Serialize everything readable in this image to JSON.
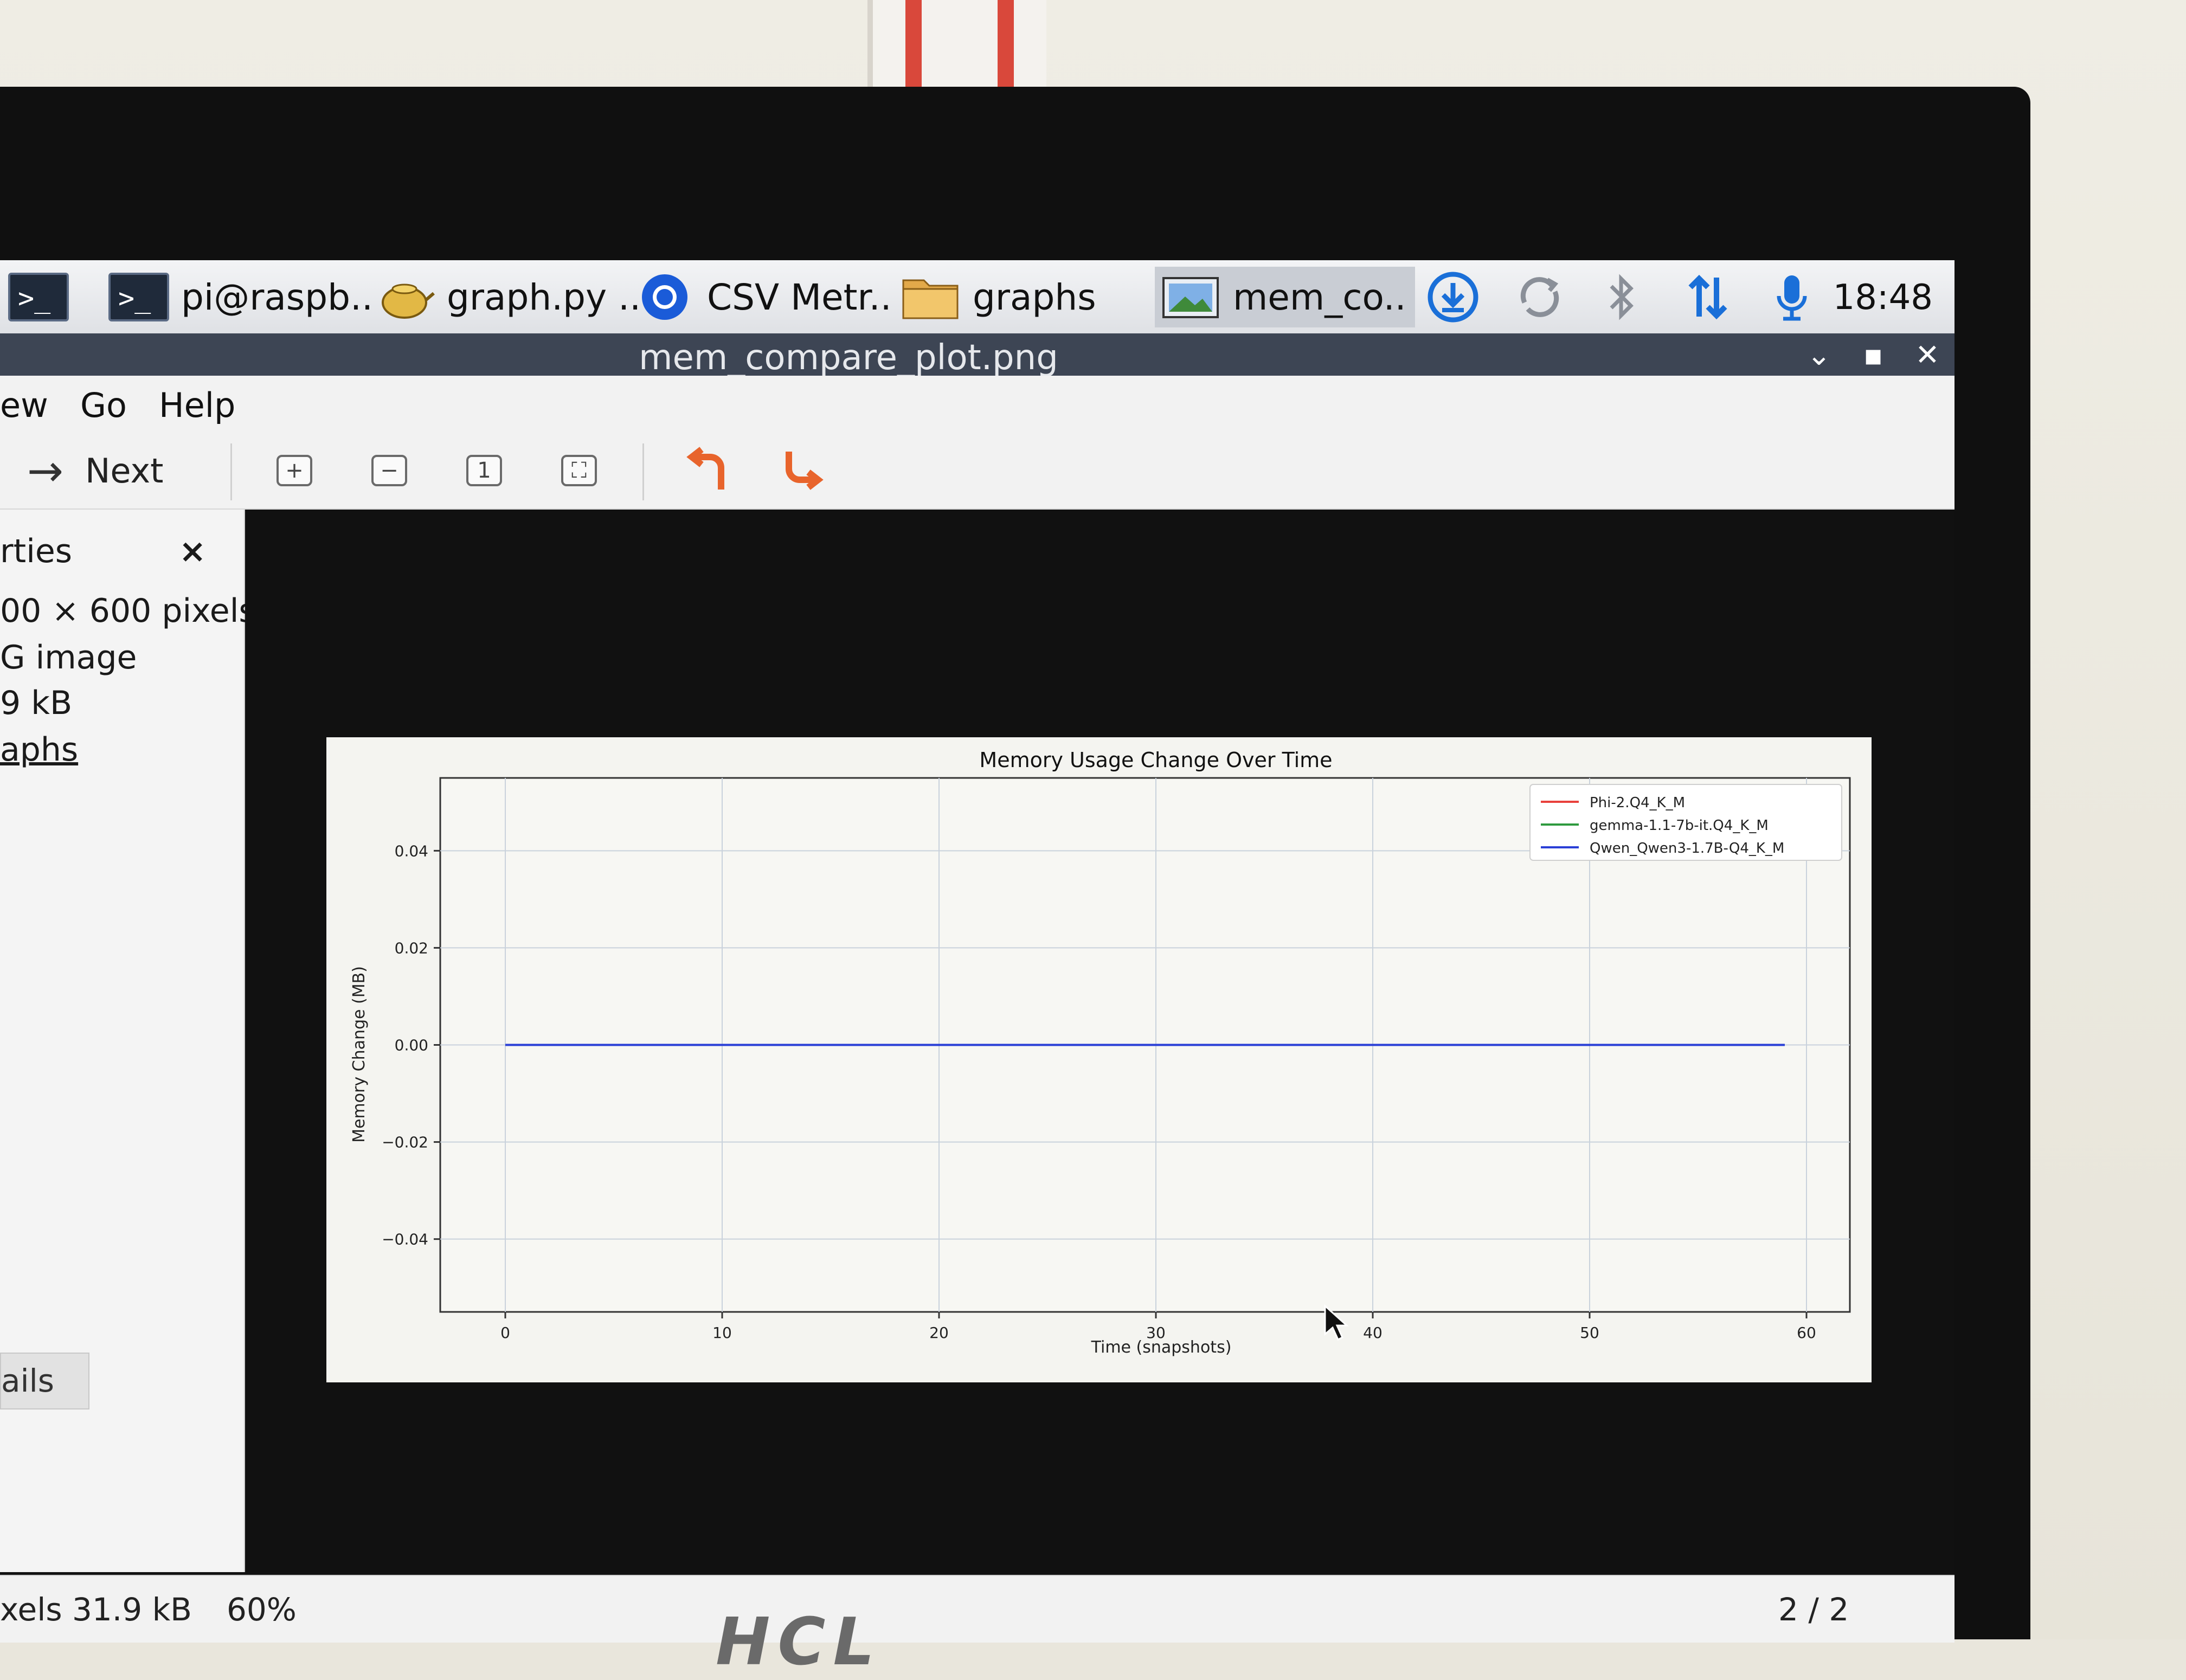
{
  "taskbar": {
    "tasks": [
      {
        "label": ""
      },
      {
        "label": "pi@raspb.."
      },
      {
        "label": "graph.py .."
      },
      {
        "label": "CSV Metr.."
      },
      {
        "label": "graphs"
      },
      {
        "label": "mem_co.."
      }
    ],
    "clock": "18:48"
  },
  "window": {
    "title": "mem_compare_plot.png"
  },
  "menubar": {
    "items": [
      "ew",
      "Go",
      "Help"
    ]
  },
  "toolbar": {
    "next_label": "Next"
  },
  "sidebar": {
    "header": "rties",
    "close": "×",
    "dimensions": "00 × 600 pixels",
    "type": "G image",
    "size": "9 kB",
    "folder": "aphs",
    "details_button": "ails"
  },
  "statusbar": {
    "pixels_size": "xels  31.9 kB",
    "zoom": "60%",
    "position": "2 / 2"
  },
  "colors": {
    "phi": "#e8413c",
    "gemma": "#2e9a3e",
    "qwen": "#2a3fd6",
    "zoom_arrows": "#e8642c"
  },
  "chart_data": {
    "type": "line",
    "title": "Memory Usage Change Over Time",
    "xlabel": "Time (snapshots)",
    "ylabel": "Memory Change (MB)",
    "xlim": [
      -3,
      62
    ],
    "ylim": [
      -0.055,
      0.055
    ],
    "x_ticks": [
      0,
      10,
      20,
      30,
      40,
      50,
      60
    ],
    "y_ticks": [
      0.04,
      0.02,
      0.0,
      -0.02,
      -0.04
    ],
    "y_tick_labels": [
      "0.04",
      "0.02",
      "0.00",
      "−0.02",
      "−0.04"
    ],
    "grid": true,
    "legend_position": "top-right",
    "series": [
      {
        "name": "Phi-2.Q4_K_M",
        "x": [
          0,
          59
        ],
        "y": [
          0,
          0
        ]
      },
      {
        "name": "gemma-1.1-7b-it.Q4_K_M",
        "x": [
          0,
          59
        ],
        "y": [
          0,
          0
        ]
      },
      {
        "name": "Qwen_Qwen3-1.7B-Q4_K_M",
        "x": [
          0,
          59
        ],
        "y": [
          0,
          0
        ]
      }
    ]
  }
}
